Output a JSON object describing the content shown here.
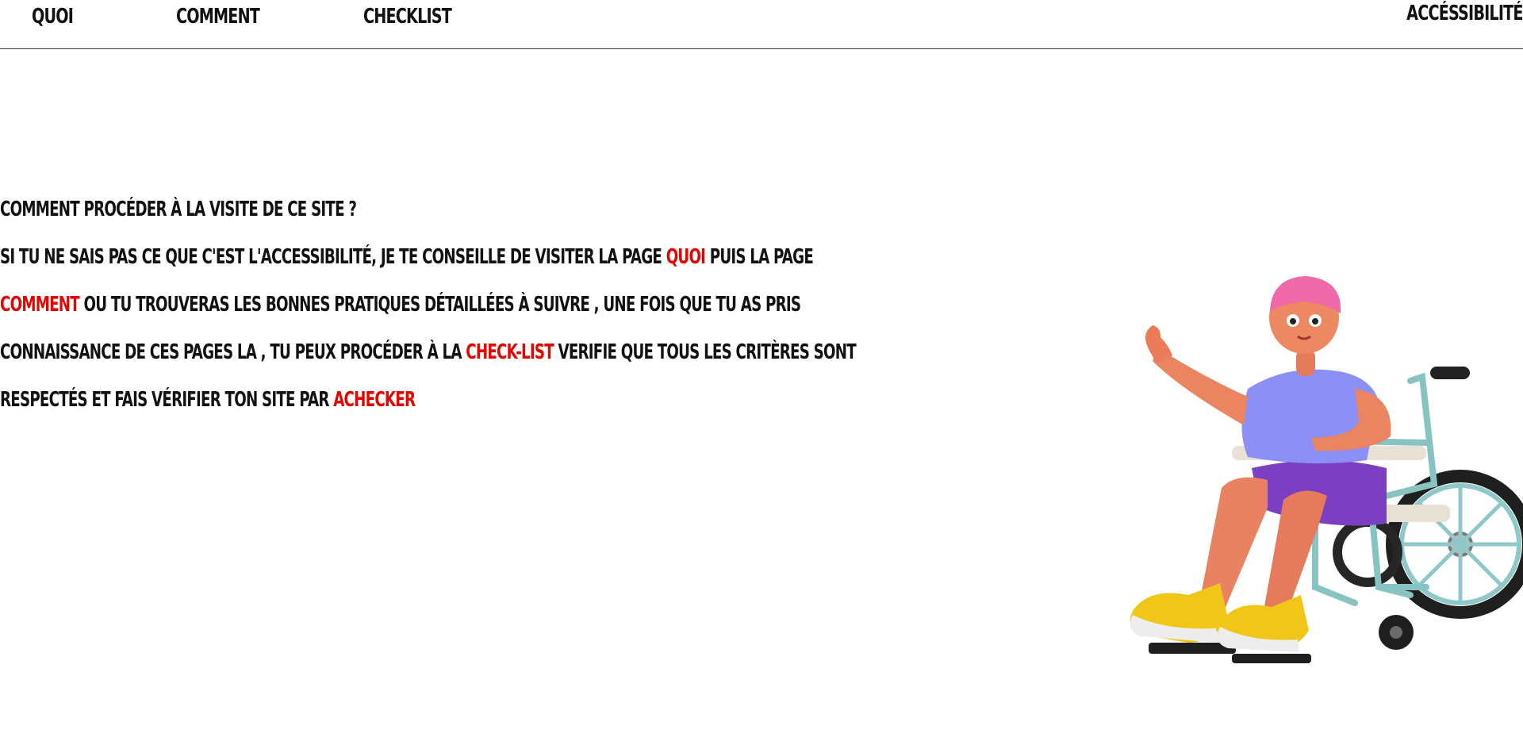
{
  "nav": {
    "quoi": "QUOI",
    "comment": "COMMENT",
    "checklist": "CHECKLIST",
    "accessibilite": "ACCÉSSIBILITÉ"
  },
  "content": {
    "heading": "COMMENT PROCÉDER À LA VISITE DE CE SITE ?",
    "line2_a": "SI TU NE SAIS PAS CE QUE C'EST L'ACCESSIBILITÉ, JE TE CONSEILLE DE VISITER LA PAGE ",
    "line2_link": "QUOI",
    "line2_b": " PUIS LA PAGE",
    "line3_link": "COMMENT",
    "line3_b": " OU TU TROUVERAS LES BONNES PRATIQUES DÉTAILLÉES À SUIVRE , UNE FOIS QUE TU AS PRIS",
    "line4_a": "CONNAISSANCE DE CES PAGES LA , TU PEUX PROCÉDER À LA ",
    "line4_link": "CHECK-LIST",
    "line4_b": " VERIFIE QUE TOUS LES CRITÈRES SONT",
    "line5_a": "RESPECTÉS ET FAIS VÉRIFIER TON SITE PAR ",
    "line5_link": "ACHECKER"
  },
  "colors": {
    "link_accent": "#e10600",
    "text": "#111111",
    "background": "#ffffff"
  },
  "illustration": {
    "icon": "wheelchair-user-illustration"
  }
}
